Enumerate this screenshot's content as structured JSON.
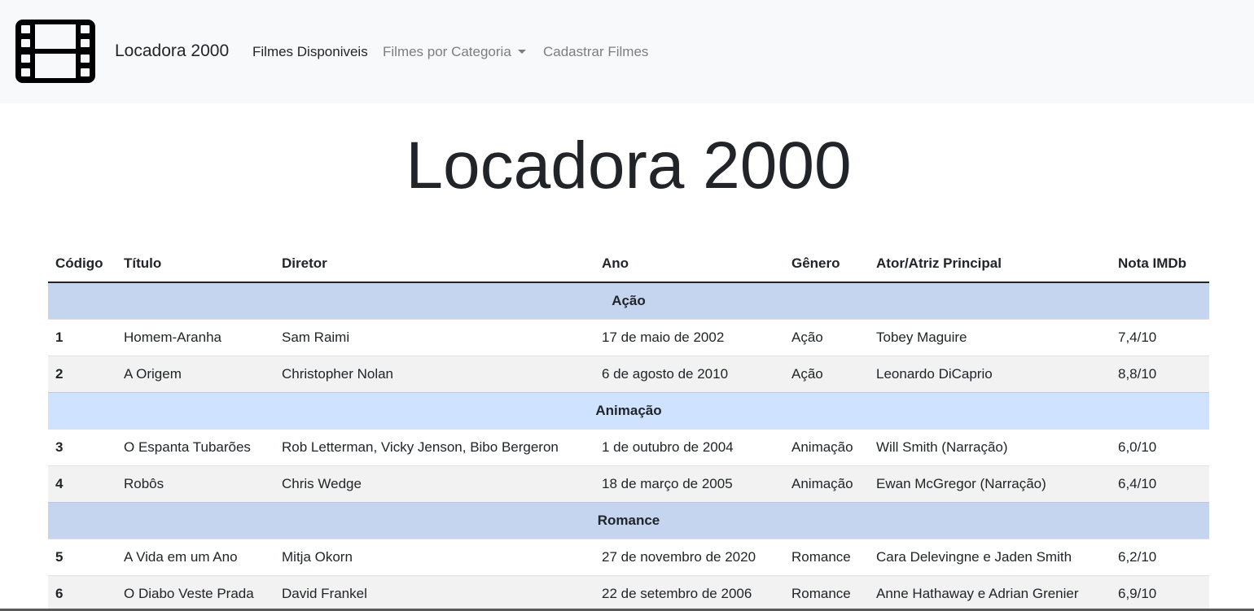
{
  "navbar": {
    "brand": "Locadora 2000",
    "links": {
      "available": "Filmes Disponiveis",
      "by_category": "Filmes por Categoria",
      "register": "Cadastrar Filmes"
    }
  },
  "page": {
    "title": "Locadora 2000"
  },
  "table": {
    "headers": [
      "Código",
      "Título",
      "Diretor",
      "Ano",
      "Gênero",
      "Ator/Atriz Principal",
      "Nota IMDb"
    ],
    "groups": [
      {
        "name": "Ação",
        "rows": [
          [
            "1",
            "Homem-Aranha",
            "Sam Raimi",
            "17 de maio de 2002",
            "Ação",
            "Tobey Maguire",
            "7,4/10"
          ],
          [
            "2",
            "A Origem",
            "Christopher Nolan",
            "6 de agosto de 2010",
            "Ação",
            "Leonardo DiCaprio",
            "8,8/10"
          ]
        ]
      },
      {
        "name": "Animação",
        "rows": [
          [
            "3",
            "O Espanta Tubarões",
            "Rob Letterman, Vicky Jenson, Bibo Bergeron",
            "1 de outubro de 2004",
            "Animação",
            "Will Smith (Narração)",
            "6,0/10"
          ],
          [
            "4",
            "Robôs",
            "Chris Wedge",
            "18 de março de 2005",
            "Animação",
            "Ewan McGregor (Narração)",
            "6,4/10"
          ]
        ]
      },
      {
        "name": "Romance",
        "rows": [
          [
            "5",
            "A Vida em um Ano",
            "Mitja Okorn",
            "27 de novembro de 2020",
            "Romance",
            "Cara Delevingne e Jaden Smith",
            "6,2/10"
          ],
          [
            "6",
            "O Diabo Veste Prada",
            "David Frankel",
            "22 de setembro de 2006",
            "Romance",
            "Anne Hathaway e Adrian Grenier",
            "6,9/10"
          ]
        ]
      }
    ]
  },
  "icons": {
    "logo": "film-icon",
    "dropdown": "caret-down-icon"
  }
}
